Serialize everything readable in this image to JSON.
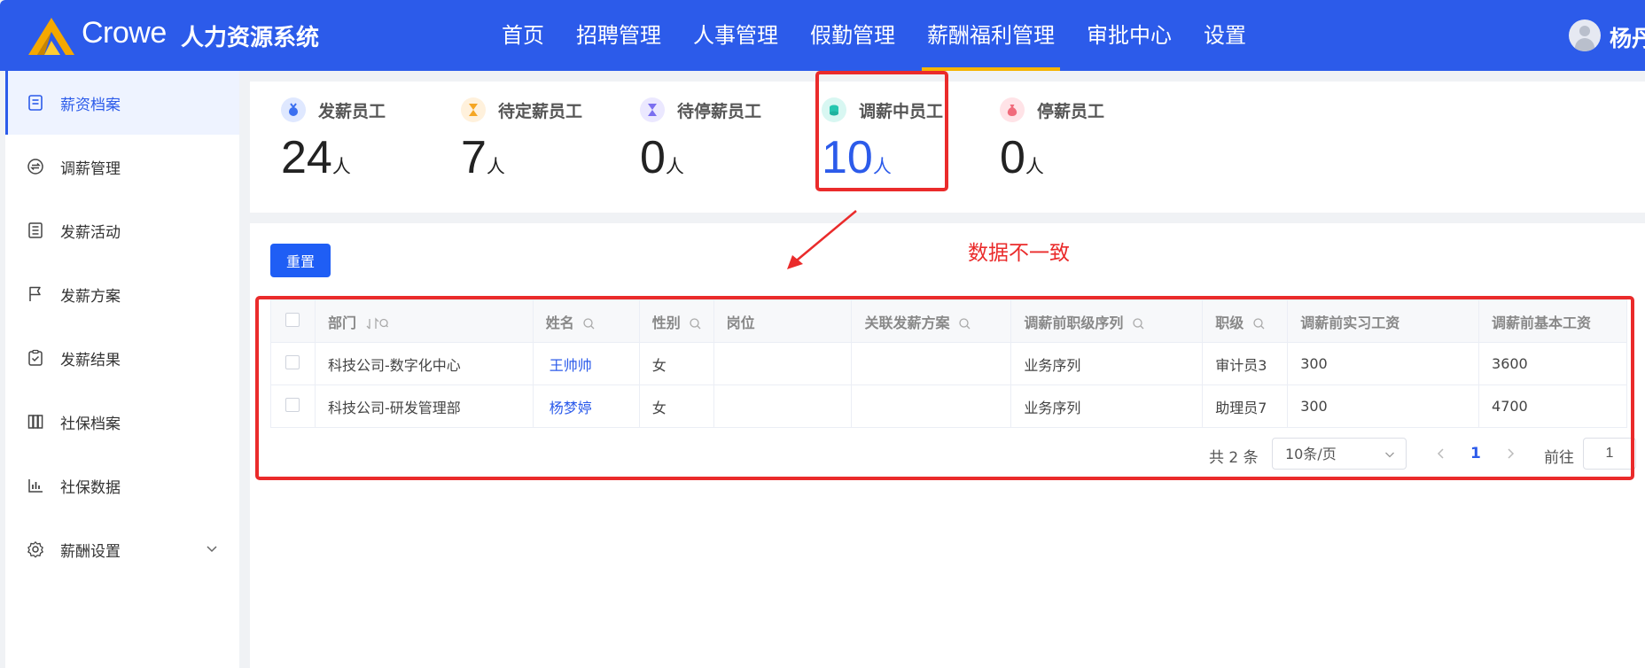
{
  "header": {
    "logo_text": "Crowe",
    "app_title": "人力资源系统",
    "nav": [
      {
        "label": "首页"
      },
      {
        "label": "招聘管理"
      },
      {
        "label": "人事管理"
      },
      {
        "label": "假勤管理"
      },
      {
        "label": "薪酬福利管理",
        "active": true
      },
      {
        "label": "审批中心"
      },
      {
        "label": "设置"
      }
    ],
    "user_name": "杨丹",
    "brand_color": "#2c5bea",
    "active_underline_color": "#f5b400"
  },
  "sidebar": {
    "items": [
      {
        "label": "薪资档案",
        "icon": "document-icon",
        "active": true
      },
      {
        "label": "调薪管理",
        "icon": "exchange-icon"
      },
      {
        "label": "发薪活动",
        "icon": "list-icon"
      },
      {
        "label": "发薪方案",
        "icon": "flag-icon"
      },
      {
        "label": "发薪结果",
        "icon": "clipboard-check-icon"
      },
      {
        "label": "社保档案",
        "icon": "archive-icon"
      },
      {
        "label": "社保数据",
        "icon": "bar-chart-icon"
      },
      {
        "label": "薪酬设置",
        "icon": "gear-icon",
        "expandable": true
      }
    ]
  },
  "stats": [
    {
      "label": "发薪员工",
      "value": "24",
      "unit": "人",
      "icon": "medal-icon",
      "color": "#3b6ff0"
    },
    {
      "label": "待定薪员工",
      "value": "7",
      "unit": "人",
      "icon": "hourglass-icon",
      "color": "#f5a623"
    },
    {
      "label": "待停薪员工",
      "value": "0",
      "unit": "人",
      "icon": "hourglass-icon",
      "color": "#7b6ff0"
    },
    {
      "label": "调薪中员工",
      "value": "10",
      "unit": "人",
      "icon": "coins-icon",
      "color": "#26c6b0",
      "highlight": true
    },
    {
      "label": "停薪员工",
      "value": "0",
      "unit": "人",
      "icon": "money-bag-icon",
      "color": "#f06b7b"
    }
  ],
  "toolbar": {
    "reset_label": "重置"
  },
  "table": {
    "columns": [
      "部门",
      "姓名",
      "性别",
      "岗位",
      "关联发薪方案",
      "调薪前职级序列",
      "职级",
      "调薪前实习工资",
      "调薪前基本工资"
    ],
    "rows": [
      {
        "dept": "科技公司-数字化中心",
        "name": "王帅帅",
        "gender": "女",
        "position": "",
        "plan": "",
        "series": "业务序列",
        "level": "审计员3",
        "intern_salary": "300",
        "base_salary": "3600"
      },
      {
        "dept": "科技公司-研发管理部",
        "name": "杨梦婷",
        "gender": "女",
        "position": "",
        "plan": "",
        "series": "业务序列",
        "level": "助理员7",
        "intern_salary": "300",
        "base_salary": "4700"
      }
    ]
  },
  "pagination": {
    "total_text": "共 2 条",
    "page_size": "10条/页",
    "current_page": "1",
    "goto_label": "前往",
    "goto_value": "1"
  },
  "annotation": {
    "text": "数据不一致",
    "color": "#ea2b2b"
  }
}
